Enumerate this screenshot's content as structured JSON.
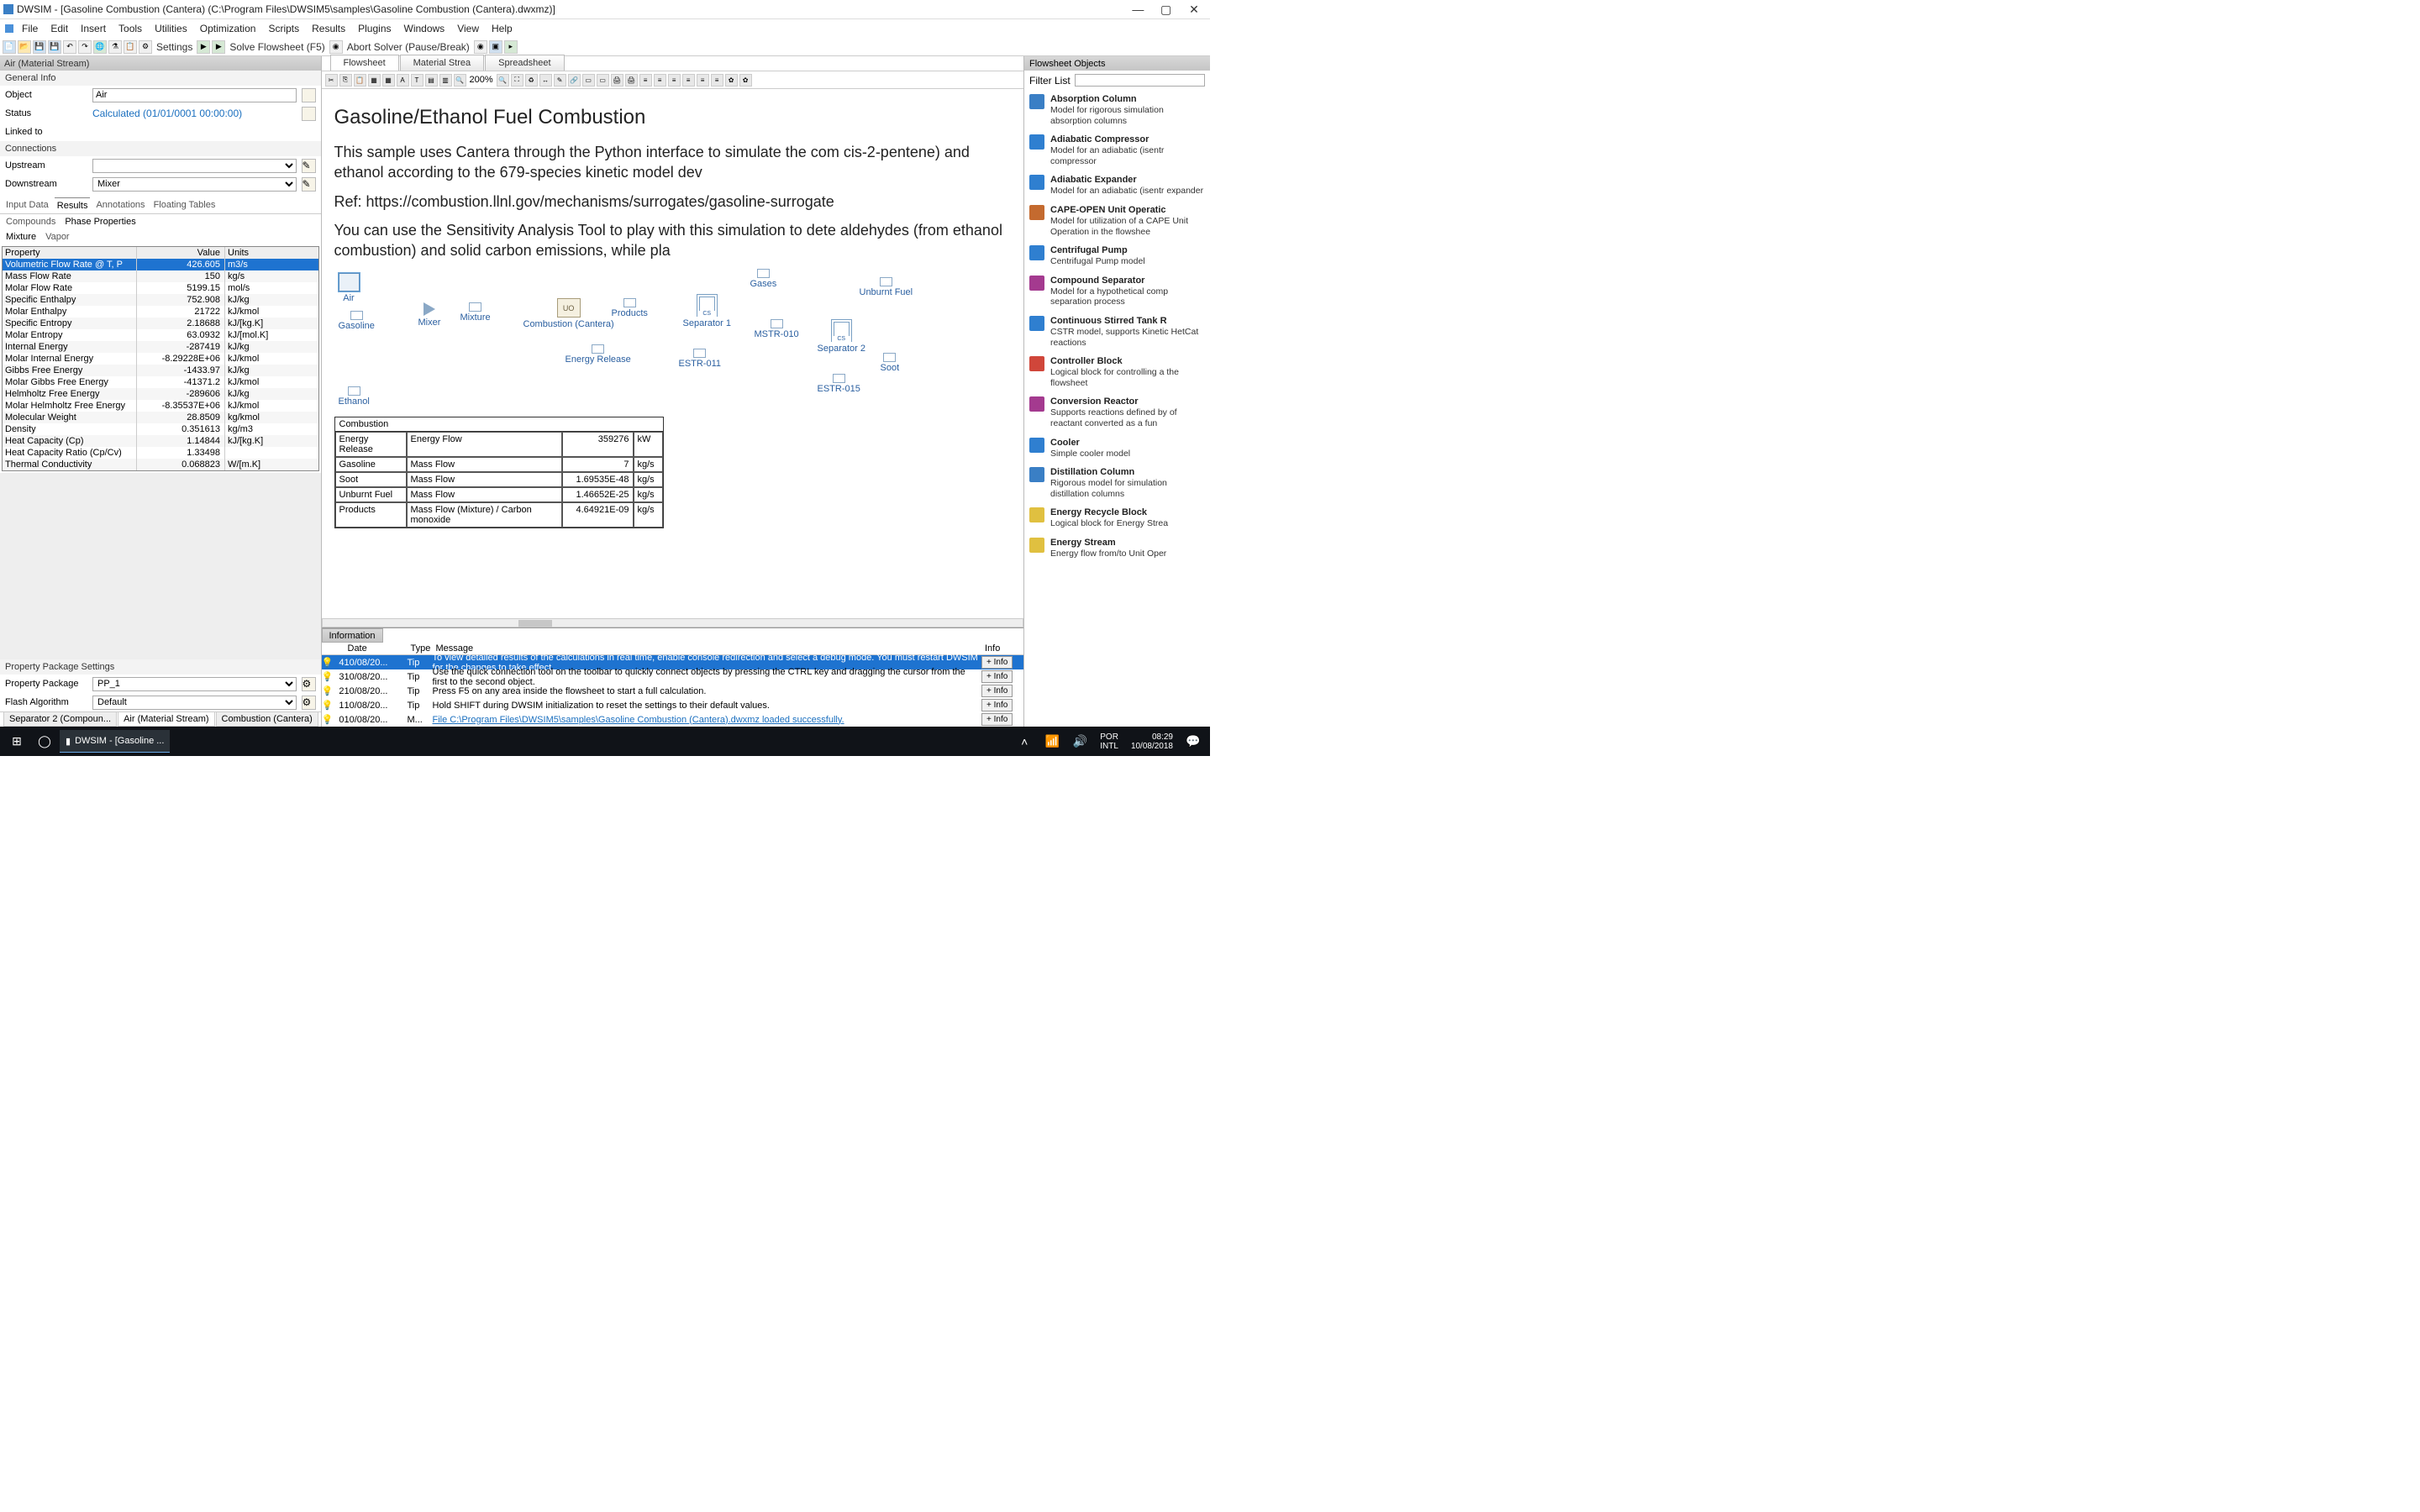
{
  "window": {
    "title": "DWSIM - [Gasoline Combustion (Cantera) (C:\\Program Files\\DWSIM5\\samples\\Gasoline Combustion (Cantera).dwxmz)]",
    "min": "—",
    "max": "▢",
    "close": "✕"
  },
  "menu": [
    "File",
    "Edit",
    "Insert",
    "Tools",
    "Utilities",
    "Optimization",
    "Scripts",
    "Results",
    "Plugins",
    "Windows",
    "View",
    "Help"
  ],
  "toolbar_actions": {
    "solve": "Solve Flowsheet (F5)",
    "abort": "Abort Solver (Pause/Break)",
    "settings": "Settings"
  },
  "left": {
    "header": "Air (Material Stream)",
    "general": "General Info",
    "object_lbl": "Object",
    "object_val": "Air",
    "status_lbl": "Status",
    "status_val": "Calculated (01/01/0001 00:00:00)",
    "linked": "Linked to",
    "connections": "Connections",
    "upstream_lbl": "Upstream",
    "upstream_val": "",
    "downstream_lbl": "Downstream",
    "downstream_val": "Mixer",
    "tabs": [
      "Input Data",
      "Results",
      "Annotations",
      "Floating Tables"
    ],
    "subtabs": [
      "Compounds",
      "Phase Properties"
    ],
    "phase_tabs": [
      "Mixture",
      "Vapor"
    ],
    "cols": {
      "p": "Property",
      "v": "Value",
      "u": "Units"
    },
    "rows": [
      {
        "p": "Volumetric Flow Rate @ T, P",
        "v": "426.605",
        "u": "m3/s",
        "sel": true
      },
      {
        "p": "Mass Flow Rate",
        "v": "150",
        "u": "kg/s"
      },
      {
        "p": "Molar Flow Rate",
        "v": "5199.15",
        "u": "mol/s"
      },
      {
        "p": "Specific Enthalpy",
        "v": "752.908",
        "u": "kJ/kg"
      },
      {
        "p": "Molar Enthalpy",
        "v": "21722",
        "u": "kJ/kmol"
      },
      {
        "p": "Specific Entropy",
        "v": "2.18688",
        "u": "kJ/[kg.K]"
      },
      {
        "p": "Molar Entropy",
        "v": "63.0932",
        "u": "kJ/[mol.K]"
      },
      {
        "p": "Internal Energy",
        "v": "-287419",
        "u": "kJ/kg"
      },
      {
        "p": "Molar Internal Energy",
        "v": "-8.29228E+06",
        "u": "kJ/kmol"
      },
      {
        "p": "Gibbs Free Energy",
        "v": "-1433.97",
        "u": "kJ/kg"
      },
      {
        "p": "Molar Gibbs Free Energy",
        "v": "-41371.2",
        "u": "kJ/kmol"
      },
      {
        "p": "Helmholtz Free Energy",
        "v": "-289606",
        "u": "kJ/kg"
      },
      {
        "p": "Molar Helmholtz Free Energy",
        "v": "-8.35537E+06",
        "u": "kJ/kmol"
      },
      {
        "p": "Molecular Weight",
        "v": "28.8509",
        "u": "kg/kmol"
      },
      {
        "p": "Density",
        "v": "0.351613",
        "u": "kg/m3"
      },
      {
        "p": "Heat Capacity (Cp)",
        "v": "1.14844",
        "u": "kJ/[kg.K]"
      },
      {
        "p": "Heat Capacity Ratio (Cp/Cv)",
        "v": "1.33498",
        "u": ""
      },
      {
        "p": "Thermal Conductivity",
        "v": "0.068823",
        "u": "W/[m.K]"
      }
    ],
    "pps": "Property Package Settings",
    "pp_lbl": "Property Package",
    "pp_val": "PP_1",
    "fa_lbl": "Flash Algorithm",
    "fa_val": "Default",
    "bottom_tabs": [
      "Separator 2 (Compoun...",
      "Air (Material Stream)",
      "Combustion (Cantera)"
    ]
  },
  "center": {
    "tabs": [
      "Flowsheet",
      "Material Strea",
      "Spreadsheet"
    ],
    "zoom": "200%",
    "title": "Gasoline/Ethanol Fuel Combustion",
    "p1": "This sample uses Cantera through the Python interface to simulate the com cis-2-pentene) and ethanol according to the 679-species kinetic model dev",
    "p2": "Ref: https://combustion.llnl.gov/mechanisms/surrogates/gasoline-surrogate",
    "p3": "You can use the Sensitivity Analysis Tool to play with this simulation to dete aldehydes (from ethanol combustion) and solid carbon emissions, while pla",
    "blocks": {
      "air": "Air",
      "gasoline": "Gasoline",
      "ethanol": "Ethanol",
      "mixer": "Mixer",
      "mixture": "Mixture",
      "uo": "UO",
      "combustion": "Combustion (Cantera)",
      "products": "Products",
      "energy": "Energy Release",
      "sep1": "Separator 1",
      "gases": "Gases",
      "unburnt": "Unburnt Fuel",
      "mstr010": "MSTR-010",
      "estr011": "ESTR-011",
      "sep2": "Separator 2",
      "soot": "Soot",
      "estr015": "ESTR-015"
    },
    "ftable": {
      "title": "Combustion",
      "rows": [
        {
          "a": "Energy Release",
          "b": "Energy Flow",
          "c": "359276",
          "d": "kW"
        },
        {
          "a": "Gasoline",
          "b": "Mass Flow",
          "c": "7",
          "d": "kg/s"
        },
        {
          "a": "Soot",
          "b": "Mass Flow",
          "c": "1.69535E-48",
          "d": "kg/s"
        },
        {
          "a": "Unburnt Fuel",
          "b": "Mass Flow",
          "c": "1.46652E-25",
          "d": "kg/s"
        },
        {
          "a": "Products",
          "b": "Mass Flow (Mixture) / Carbon monoxide",
          "c": "4.64921E-09",
          "d": "kg/s"
        }
      ]
    }
  },
  "info": {
    "title": "Information",
    "cols": {
      "date": "Date",
      "type": "Type",
      "msg": "Message",
      "info": "Info"
    },
    "rows": [
      {
        "n": "4",
        "d": "10/08/20...",
        "t": "Tip",
        "m": "To view detailed results of the calculations in real time, enable console redirection and select a debug mode. You must restart DWSIM for the changes to take effect.",
        "sel": true
      },
      {
        "n": "3",
        "d": "10/08/20...",
        "t": "Tip",
        "m": "Use the quick connection tool on the toolbar to quickly connect objects by pressing the CTRL key and dragging the cursor from the first to the second object."
      },
      {
        "n": "2",
        "d": "10/08/20...",
        "t": "Tip",
        "m": "Press F5 on any area inside the flowsheet to start a full calculation."
      },
      {
        "n": "1",
        "d": "10/08/20...",
        "t": "Tip",
        "m": "Hold SHIFT during DWSIM initialization to reset the settings to their default values."
      },
      {
        "n": "0",
        "d": "10/08/20...",
        "t": "M...",
        "m": "File C:\\Program Files\\DWSIM5\\samples\\Gasoline Combustion (Cantera).dwxmz loaded successfully.",
        "link": true
      }
    ],
    "info_btn": "+ Info"
  },
  "right": {
    "header": "Flowsheet Objects",
    "filter": "Filter List",
    "items": [
      {
        "n": "Absorption Column",
        "d": "Model for rigorous simulation absorption columns",
        "c": "#3a7fc5"
      },
      {
        "n": "Adiabatic Compressor",
        "d": "Model for an adiabatic (isentr compressor",
        "c": "#2f7fd0"
      },
      {
        "n": "Adiabatic Expander",
        "d": "Model for an adiabatic (isentr expander",
        "c": "#2f7fd0"
      },
      {
        "n": "CAPE-OPEN Unit Operatic",
        "d": "Model for utilization of a CAPE Unit Operation in the flowshee",
        "c": "#c46a2f"
      },
      {
        "n": "Centrifugal Pump",
        "d": "Centrifugal Pump model",
        "c": "#2f7fd0"
      },
      {
        "n": "Compound Separator",
        "d": "Model for a hypothetical comp separation process",
        "c": "#a43a8f"
      },
      {
        "n": "Continuous Stirred Tank R",
        "d": "CSTR model, supports Kinetic HetCat reactions",
        "c": "#2f7fd0"
      },
      {
        "n": "Controller Block",
        "d": "Logical block for controlling a the flowsheet",
        "c": "#d0463a"
      },
      {
        "n": "Conversion Reactor",
        "d": "Supports reactions defined by of reactant converted as a fun",
        "c": "#a43a8f"
      },
      {
        "n": "Cooler",
        "d": "Simple cooler model",
        "c": "#2f7fd0"
      },
      {
        "n": "Distillation Column",
        "d": "Rigorous model for simulation distillation columns",
        "c": "#3a7fc5"
      },
      {
        "n": "Energy Recycle Block",
        "d": "Logical block for Energy Strea",
        "c": "#e0c040"
      },
      {
        "n": "Energy Stream",
        "d": "Energy flow from/to Unit Oper",
        "c": "#e0c040"
      }
    ]
  },
  "taskbar": {
    "app": "DWSIM - [Gasoline ...",
    "lang": "POR",
    "kb": "INTL",
    "time": "08:29",
    "date": "10/08/2018"
  }
}
